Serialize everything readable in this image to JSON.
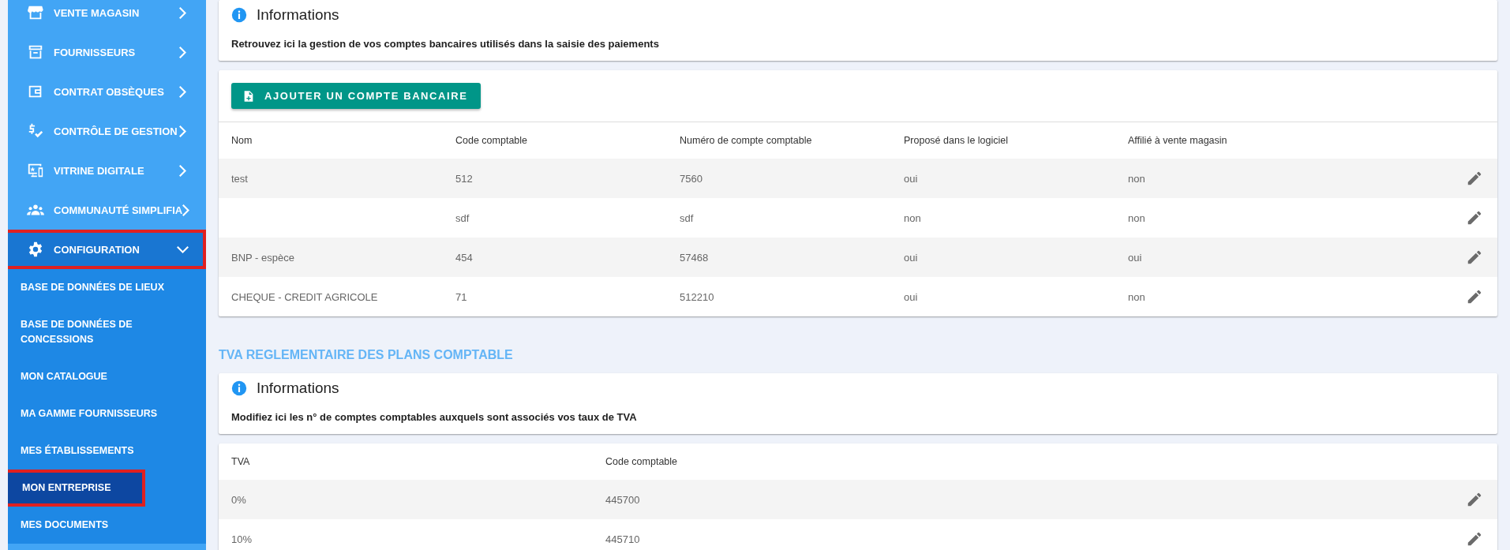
{
  "sidebar": {
    "items": [
      {
        "label": "VENTE MAGASIN",
        "expanded": false,
        "highlighted": false
      },
      {
        "label": "FOURNISSEURS",
        "expanded": false,
        "highlighted": false
      },
      {
        "label": "CONTRAT OBSÈQUES",
        "expanded": false,
        "highlighted": false
      },
      {
        "label": "CONTRÔLE DE GESTION",
        "expanded": false,
        "highlighted": false
      },
      {
        "label": "VITRINE DIGITALE",
        "expanded": false,
        "highlighted": false
      },
      {
        "label": "COMMUNAUTÉ SIMPLIFIA",
        "expanded": false,
        "highlighted": false
      },
      {
        "label": "CONFIGURATION",
        "expanded": true,
        "highlighted": true,
        "children": [
          {
            "label": "BASE DE DONNÉES DE LIEUX",
            "selected": false,
            "highlighted": false
          },
          {
            "label": "BASE DE DONNÉES DE CONCESSIONS",
            "selected": false,
            "highlighted": false
          },
          {
            "label": "MON CATALOGUE",
            "selected": false,
            "highlighted": false
          },
          {
            "label": "MA GAMME FOURNISSEURS",
            "selected": false,
            "highlighted": false
          },
          {
            "label": "MES ÉTABLISSEMENTS",
            "selected": false,
            "highlighted": false
          },
          {
            "label": "MON ENTREPRISE",
            "selected": true,
            "highlighted": true
          },
          {
            "label": "MES DOCUMENTS",
            "selected": false,
            "highlighted": false
          }
        ]
      }
    ]
  },
  "bank_info": {
    "title": "Informations",
    "text": "Retrouvez ici la gestion de vos comptes bancaires utilisés dans la saisie des paiements"
  },
  "bank_table": {
    "add_button": "AJOUTER UN COMPTE BANCAIRE",
    "columns": [
      "Nom",
      "Code comptable",
      "Numéro de compte comptable",
      "Proposé dans le logiciel",
      "Affilié à vente magasin"
    ],
    "rows": [
      [
        "test",
        "512",
        "7560",
        "oui",
        "non"
      ],
      [
        "",
        "sdf",
        "sdf",
        "non",
        "non"
      ],
      [
        "BNP - espèce",
        "454",
        "57468",
        "oui",
        "oui"
      ],
      [
        "CHEQUE - CREDIT AGRICOLE",
        "71",
        "512210",
        "oui",
        "non"
      ]
    ]
  },
  "tva_section": {
    "heading": "TVA REGLEMENTAIRE DES PLANS COMPTABLE",
    "info": {
      "title": "Informations",
      "text": "Modifiez ici les n° de comptes comptables auxquels sont associés vos taux de TVA"
    },
    "columns": [
      "TVA",
      "Code comptable"
    ],
    "rows": [
      [
        "0%",
        "445700"
      ],
      [
        "10%",
        "445710"
      ]
    ]
  }
}
